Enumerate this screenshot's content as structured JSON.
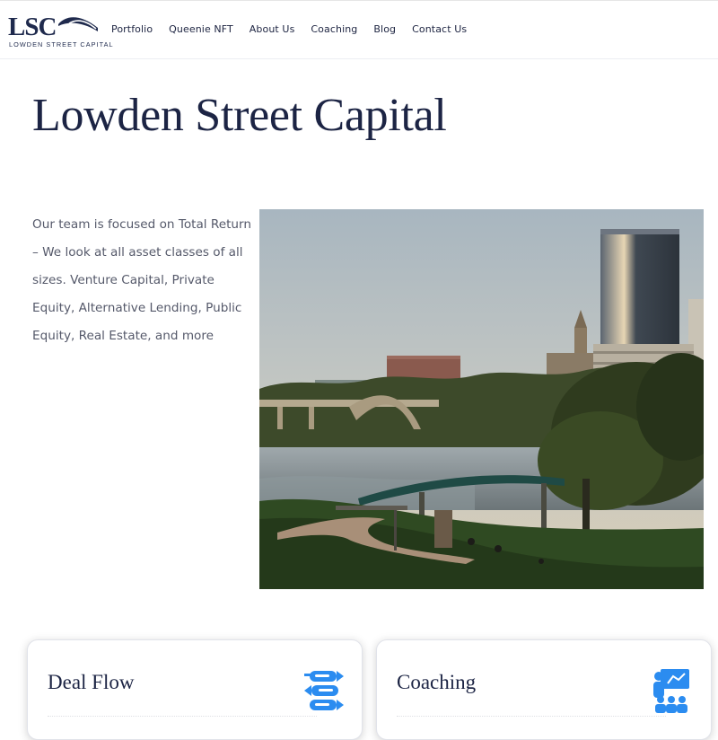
{
  "header": {
    "logo_text": "LSC",
    "logo_subtitle": "LOWDEN STREET CAPITAL",
    "nav": [
      "Portfolio",
      "Queenie NFT",
      "About Us",
      "Coaching",
      "Blog",
      "Contact Us"
    ]
  },
  "hero": {
    "title": "Lowden Street Capital",
    "intro": "Our team is focused on Total Return – We look at all asset classes of all sizes. Venture Capital, Private Equity, Alternative Lending, Public Equity, Real Estate, and more"
  },
  "cards": [
    {
      "title": "Deal Flow",
      "icon": "deal-flow-icon"
    },
    {
      "title": "Coaching",
      "icon": "coaching-icon"
    }
  ],
  "colors": {
    "navy": "#1c2444",
    "accent_blue": "#2b8cf0",
    "body_text": "#55596a"
  }
}
